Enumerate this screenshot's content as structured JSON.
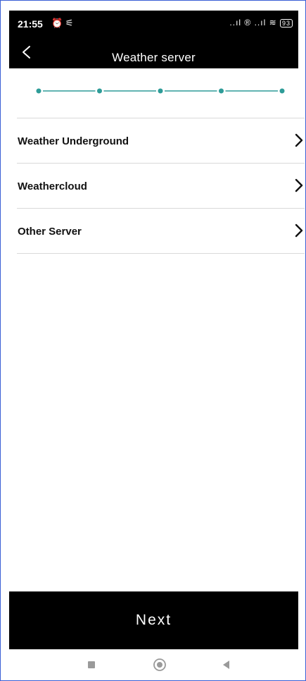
{
  "status_bar": {
    "time": "21:55",
    "left_icons": "⏰ ⚟",
    "right_icons": "..ıl ® ..ıl ≋",
    "battery": "93"
  },
  "header": {
    "title": "Weather server",
    "back_icon": "chevron-left-icon"
  },
  "stepper": {
    "steps": 5,
    "color": "#2e9c98"
  },
  "server_list": {
    "items": [
      {
        "label": "Weather Underground",
        "icon": "chevron-right-icon"
      },
      {
        "label": "Weathercloud",
        "icon": "chevron-right-icon"
      },
      {
        "label": "Other Server",
        "icon": "chevron-right-icon"
      }
    ]
  },
  "footer": {
    "next_label": "Next"
  },
  "nav_bar": {
    "icons": [
      "square-icon",
      "circle-icon",
      "triangle-back-icon"
    ]
  }
}
